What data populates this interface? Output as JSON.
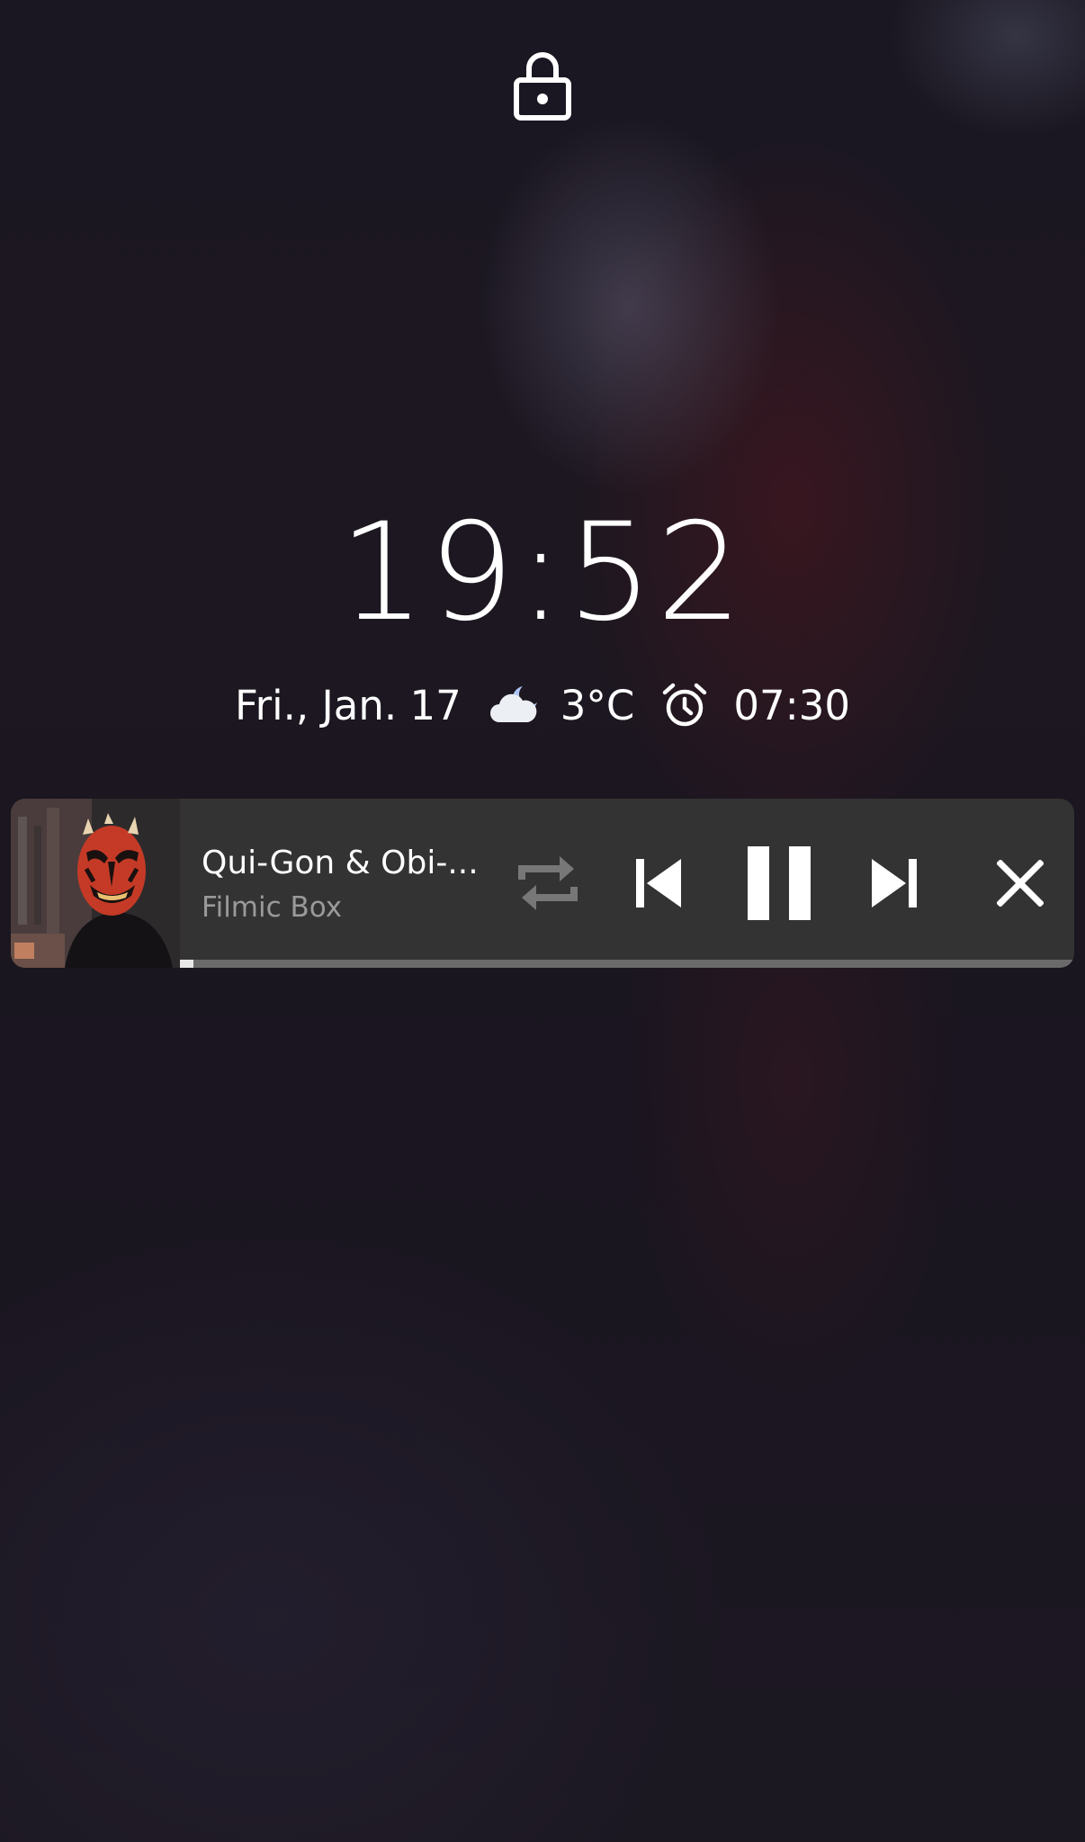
{
  "lockscreen": {
    "time": "19:52",
    "date": "Fri., Jan. 17",
    "weather_icon": "cloud-moon-icon",
    "temperature": "3°C",
    "alarm_icon": "alarm-clock-icon",
    "alarm_time": "07:30"
  },
  "media": {
    "title": "Qui-Gon & Obi-...",
    "artist": "Filmic Box",
    "progress": 0.015,
    "controls": [
      "repeat-icon",
      "skip-previous-icon",
      "pause-icon",
      "skip-next-icon",
      "close-icon"
    ],
    "colors": {
      "card": "#333333",
      "repeat_disabled": "#777777",
      "progress_track": "#6a6a6a",
      "progress_fill": "#e8e8e8"
    }
  }
}
